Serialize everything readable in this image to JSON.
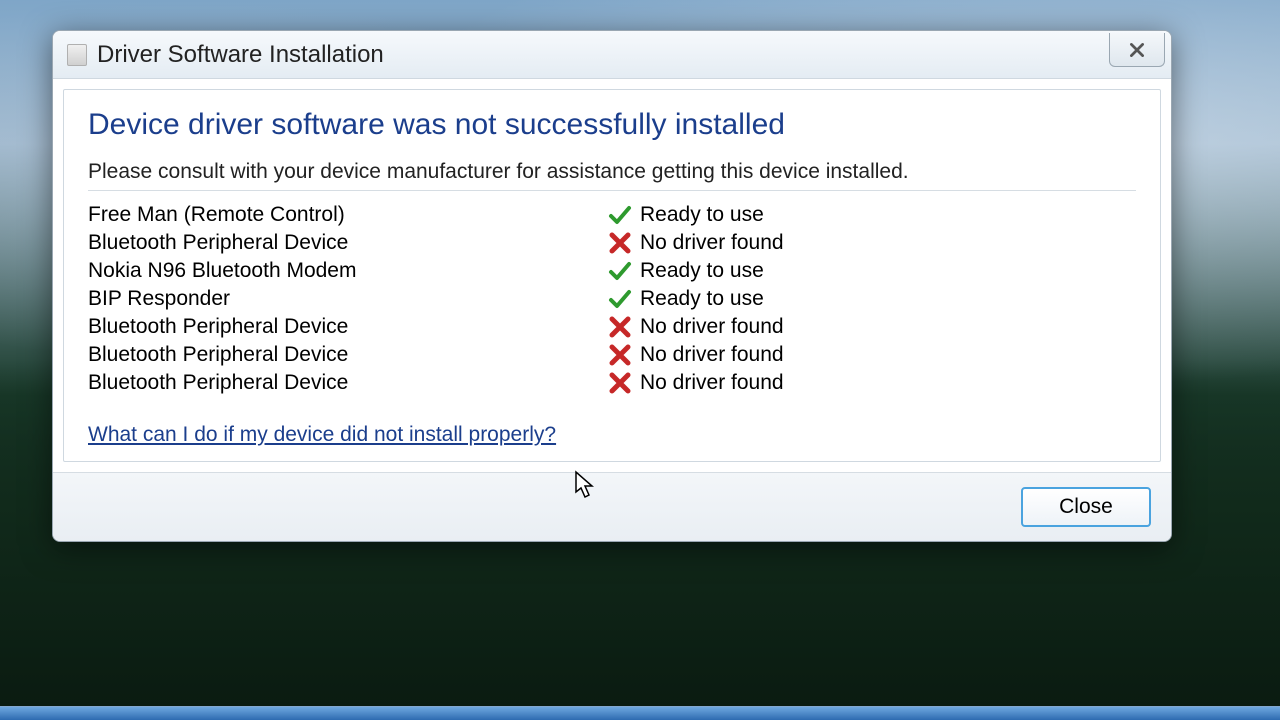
{
  "window": {
    "title": "Driver Software Installation",
    "close_x_label": "Close window"
  },
  "content": {
    "heading": "Device driver software was not successfully installed",
    "subtext": "Please consult with your device manufacturer for assistance getting this device installed.",
    "devices": [
      {
        "name": "Free Man (Remote Control)",
        "status": "Ready to use",
        "ok": true
      },
      {
        "name": "Bluetooth Peripheral Device",
        "status": "No driver found",
        "ok": false
      },
      {
        "name": "Nokia N96 Bluetooth Modem",
        "status": "Ready to use",
        "ok": true
      },
      {
        "name": "BIP Responder",
        "status": "Ready to use",
        "ok": true
      },
      {
        "name": "Bluetooth Peripheral Device",
        "status": "No driver found",
        "ok": false
      },
      {
        "name": "Bluetooth Peripheral Device",
        "status": "No driver found",
        "ok": false
      },
      {
        "name": "Bluetooth Peripheral Device",
        "status": "No driver found",
        "ok": false
      }
    ],
    "help_link": "What can I do if my device did not install properly?"
  },
  "footer": {
    "close_label": "Close"
  }
}
